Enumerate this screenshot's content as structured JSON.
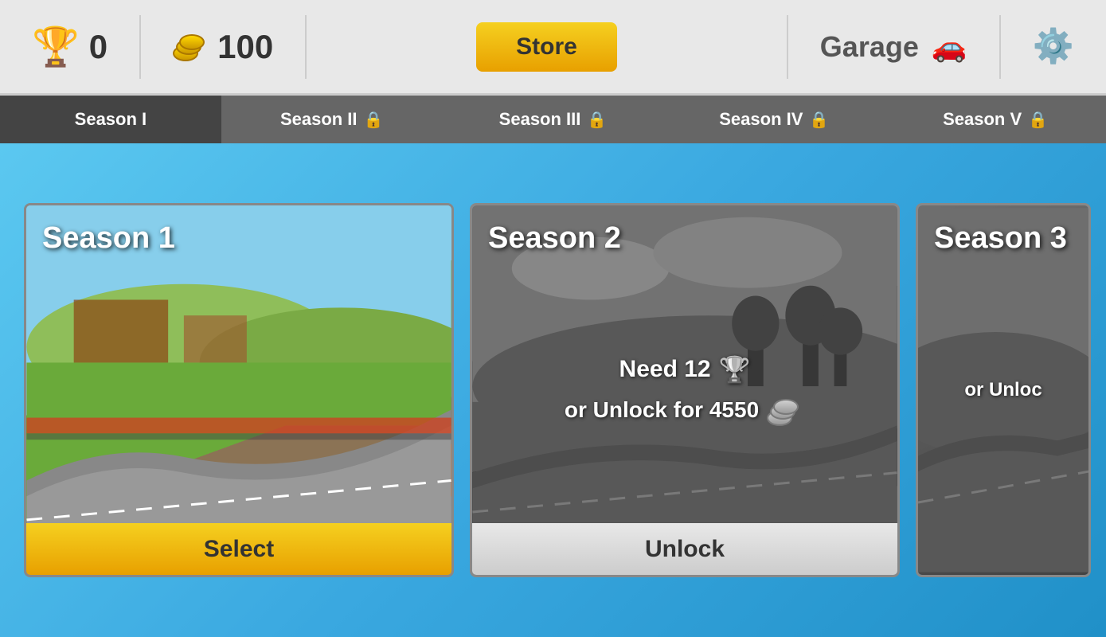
{
  "header": {
    "trophy_count": "0",
    "coins_count": "100",
    "store_label": "Store",
    "garage_label": "Garage"
  },
  "tabs": [
    {
      "id": "season-1",
      "label": "Season I",
      "active": true,
      "locked": false
    },
    {
      "id": "season-2",
      "label": "Season II",
      "active": false,
      "locked": true
    },
    {
      "id": "season-3",
      "label": "Season III",
      "active": false,
      "locked": true
    },
    {
      "id": "season-4",
      "label": "Season IV",
      "active": false,
      "locked": true
    },
    {
      "id": "season-5",
      "label": "Season V",
      "active": false,
      "locked": true
    }
  ],
  "cards": [
    {
      "title": "Season 1",
      "locked": false,
      "button_label": "Select"
    },
    {
      "title": "Season 2",
      "locked": true,
      "need_trophies": "12",
      "unlock_coins": "4550",
      "need_label": "Need 12",
      "unlock_label": "or Unlock for 4550",
      "button_label": "Unlock"
    },
    {
      "title": "Season 3",
      "locked": true,
      "partial": true,
      "unlock_label": "or Unloc",
      "button_label": ""
    }
  ]
}
